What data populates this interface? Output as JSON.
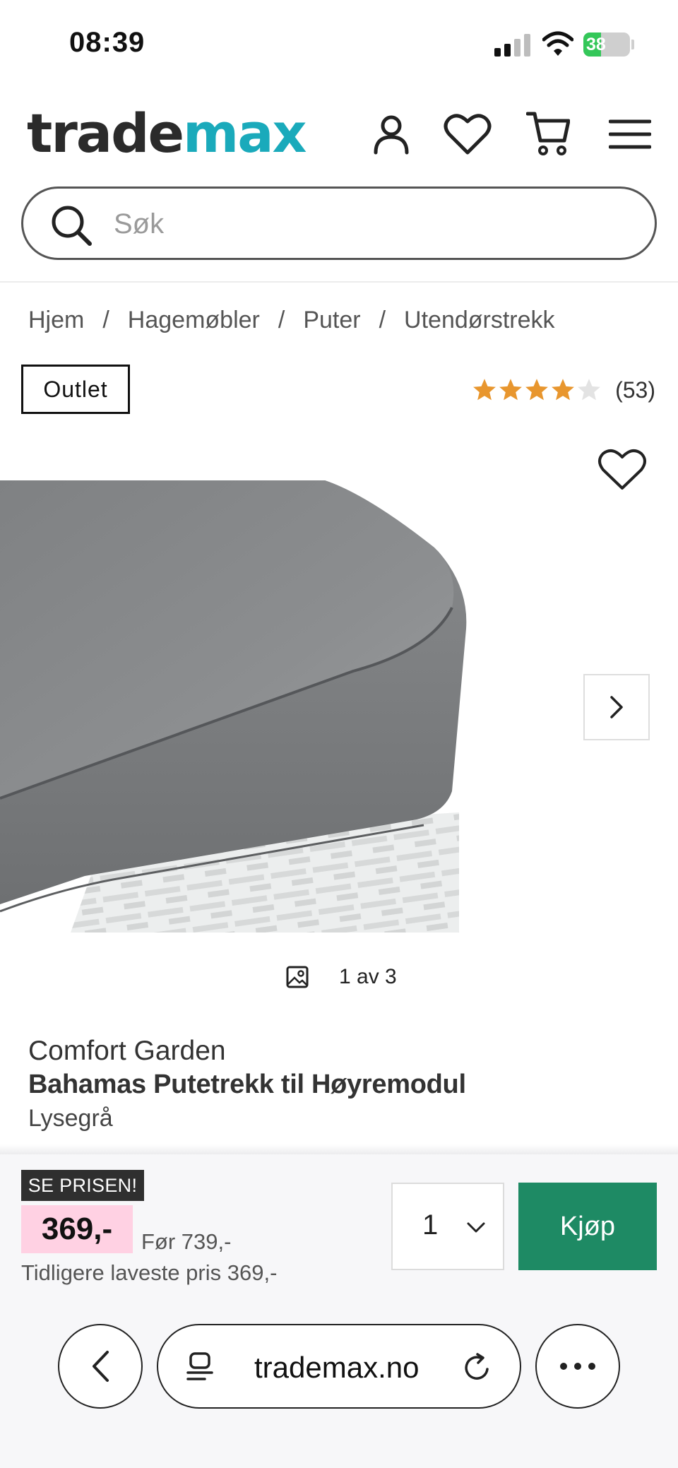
{
  "status_bar": {
    "time": "08:39",
    "battery": "38",
    "battery_level": 0.38
  },
  "header": {
    "logo_part1": "trade",
    "logo_part2": "max",
    "icons": [
      "account-icon",
      "heart-icon",
      "cart-icon",
      "menu-icon"
    ]
  },
  "search": {
    "placeholder": "Søk",
    "value": ""
  },
  "breadcrumb": {
    "items": [
      "Hjem",
      "Hagemøbler",
      "Puter",
      "Utendørstrekk"
    ],
    "separator": "/"
  },
  "product": {
    "badge": "Outlet",
    "rating": 4,
    "rating_max": 5,
    "review_count": "(53)",
    "image_counter": "1 av 3",
    "brand": "Comfort Garden",
    "name": "Bahamas Putetrekk til Høyremodul",
    "variant": "Lysegrå"
  },
  "purchase": {
    "price_label": "SE PRISEN!",
    "price": "369,-",
    "before_price": "Før 739,-",
    "lowest_price": "Tidligere laveste pris 369,-",
    "quantity": "1",
    "buy_label": "Kjøp"
  },
  "browser": {
    "url": "trademax.no"
  },
  "colors": {
    "brand_dark": "#2b2b2b",
    "brand_teal": "#1aaabb",
    "buy_green": "#1e8a64",
    "price_highlight": "#ffd1e3",
    "star": "#e8962e"
  }
}
